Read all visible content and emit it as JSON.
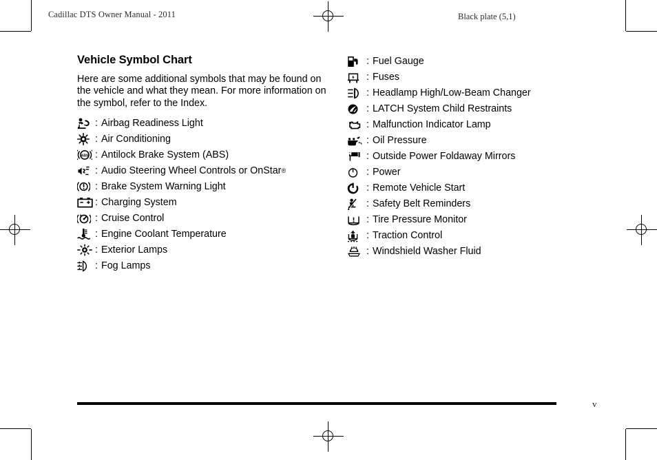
{
  "header": {
    "left_text": "Cadillac DTS Owner Manual - 2011",
    "right_text": "Black plate (5,1)"
  },
  "main": {
    "title": "Vehicle Symbol Chart",
    "intro": "Here are some additional symbols that may be found on the vehicle and what they mean. For more information on the symbol, refer to the Index.",
    "separator": ":",
    "left_column": [
      {
        "icon": "airbag-icon",
        "label": "Airbag Readiness Light"
      },
      {
        "icon": "air-conditioning-icon",
        "label": "Air Conditioning"
      },
      {
        "icon": "abs-icon",
        "label": "Antilock Brake System (ABS)"
      },
      {
        "icon": "audio-steering-wheel-icon",
        "label": "Audio Steering Wheel Controls or OnStar",
        "superscript": "®"
      },
      {
        "icon": "brake-warning-icon",
        "label": "Brake System Warning Light"
      },
      {
        "icon": "charging-system-icon",
        "label": "Charging System"
      },
      {
        "icon": "cruise-control-icon",
        "label": "Cruise Control"
      },
      {
        "icon": "engine-coolant-temp-icon",
        "label": "Engine Coolant Temperature"
      },
      {
        "icon": "exterior-lamps-icon",
        "label": "Exterior Lamps"
      },
      {
        "icon": "fog-lamps-icon",
        "label": "Fog Lamps"
      }
    ],
    "right_column": [
      {
        "icon": "fuel-gauge-icon",
        "label": "Fuel Gauge"
      },
      {
        "icon": "fuses-icon",
        "label": "Fuses"
      },
      {
        "icon": "headlamp-beam-changer-icon",
        "label": "Headlamp High/Low-Beam Changer"
      },
      {
        "icon": "latch-child-restraint-icon",
        "label": "LATCH System Child Restraints"
      },
      {
        "icon": "malfunction-indicator-icon",
        "label": "Malfunction Indicator Lamp"
      },
      {
        "icon": "oil-pressure-icon",
        "label": "Oil Pressure"
      },
      {
        "icon": "foldaway-mirrors-icon",
        "label": "Outside Power Foldaway Mirrors"
      },
      {
        "icon": "power-icon",
        "label": "Power"
      },
      {
        "icon": "remote-vehicle-start-icon",
        "label": "Remote Vehicle Start"
      },
      {
        "icon": "safety-belt-icon",
        "label": "Safety Belt Reminders"
      },
      {
        "icon": "tire-pressure-icon",
        "label": "Tire Pressure Monitor"
      },
      {
        "icon": "traction-control-icon",
        "label": "Traction Control"
      },
      {
        "icon": "windshield-washer-icon",
        "label": "Windshield Washer Fluid"
      }
    ]
  },
  "footer": {
    "page_number": "v"
  },
  "colors": {
    "text": "#000000",
    "header_text": "#2b2b2b",
    "rule": "#000000"
  }
}
